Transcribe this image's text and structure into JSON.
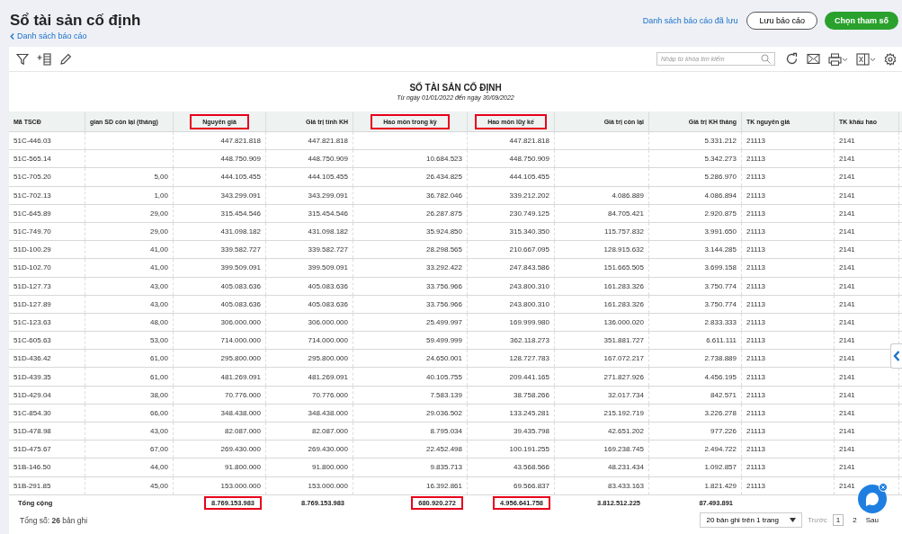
{
  "page": {
    "title": "Sổ tài sản cố định",
    "back_link": "Danh sách báo cáo",
    "saved_reports_link": "Danh sách báo cáo đã lưu",
    "save_button": "Lưu báo cáo",
    "params_button": "Chọn tham số"
  },
  "toolbar": {
    "search": {
      "placeholder": "Nhập từ khóa tìm kiếm"
    }
  },
  "report": {
    "title": "SỐ TÀI SẢN CỐ ĐỊNH",
    "subtitle": "Từ ngày 01/01/2022 đến ngày 30/09/2022"
  },
  "table": {
    "columns": [
      {
        "label": "Mã TSCĐ",
        "highlighted": false
      },
      {
        "label": "gian SD còn lại (tháng)",
        "highlighted": false
      },
      {
        "label": "Nguyên giá",
        "highlighted": true
      },
      {
        "label": "Giá trị tính KH",
        "highlighted": false
      },
      {
        "label": "Hao mòn trong kỳ",
        "highlighted": true
      },
      {
        "label": "Hao mòn lũy kế",
        "highlighted": true
      },
      {
        "label": "Giá trị còn lại",
        "highlighted": false
      },
      {
        "label": "Giá trị KH tháng",
        "highlighted": false
      },
      {
        "label": "TK nguyên giá",
        "highlighted": false
      },
      {
        "label": "TK khấu hao",
        "highlighted": false
      }
    ],
    "rows": [
      [
        "51C-446.03",
        "",
        "447.821.818",
        "447.821.818",
        "",
        "447.821.818",
        "",
        "5.331.212",
        "21113",
        "2141"
      ],
      [
        "51C-565.14",
        "",
        "448.750.909",
        "448.750.909",
        "10.684.523",
        "448.750.909",
        "",
        "5.342.273",
        "21113",
        "2141"
      ],
      [
        "51C-705.20",
        "5,00",
        "444.105.455",
        "444.105.455",
        "26.434.825",
        "444.105.455",
        "",
        "5.286.970",
        "21113",
        "2141"
      ],
      [
        "51C-702.13",
        "1,00",
        "343.299.091",
        "343.299.091",
        "36.782.046",
        "339.212.202",
        "4.086.889",
        "4.086.894",
        "21113",
        "2141"
      ],
      [
        "51C-645.89",
        "29,00",
        "315.454.546",
        "315.454.546",
        "26.287.875",
        "230.749.125",
        "84.705.421",
        "2.920.875",
        "21113",
        "2141"
      ],
      [
        "51C-749.70",
        "29,00",
        "431.098.182",
        "431.098.182",
        "35.924.850",
        "315.340.350",
        "115.757.832",
        "3.991.650",
        "21113",
        "2141"
      ],
      [
        "51D-100.29",
        "41,00",
        "339.582.727",
        "339.582.727",
        "28.298.565",
        "210.667.095",
        "128.915.632",
        "3.144.285",
        "21113",
        "2141"
      ],
      [
        "51D-102.70",
        "41,00",
        "399.509.091",
        "399.509.091",
        "33.292.422",
        "247.843.586",
        "151.665.505",
        "3.699.158",
        "21113",
        "2141"
      ],
      [
        "51D-127.73",
        "43,00",
        "405.083.636",
        "405.083.636",
        "33.756.966",
        "243.800.310",
        "161.283.326",
        "3.750.774",
        "21113",
        "2141"
      ],
      [
        "51D-127.89",
        "43,00",
        "405.083.636",
        "405.083.636",
        "33.756.966",
        "243.800.310",
        "161.283.326",
        "3.750.774",
        "21113",
        "2141"
      ],
      [
        "51C-123.63",
        "48,00",
        "306.000.000",
        "306.000.000",
        "25.499.997",
        "169.999.980",
        "136.000.020",
        "2.833.333",
        "21113",
        "2141"
      ],
      [
        "51C-605.63",
        "53,00",
        "714.000.000",
        "714.000.000",
        "59.499.999",
        "362.118.273",
        "351.881.727",
        "6.611.111",
        "21113",
        "2141"
      ],
      [
        "51D-436.42",
        "61,00",
        "295.800.000",
        "295.800.000",
        "24.650.001",
        "128.727.783",
        "167.072.217",
        "2.738.889",
        "21113",
        "2141"
      ],
      [
        "51D-439.35",
        "61,00",
        "481.269.091",
        "481.269.091",
        "40.105.755",
        "209.441.165",
        "271.827.926",
        "4.456.195",
        "21113",
        "2141"
      ],
      [
        "51D-429.04",
        "38,00",
        "70.776.000",
        "70.776.000",
        "7.583.139",
        "38.758.266",
        "32.017.734",
        "842.571",
        "21113",
        "2141"
      ],
      [
        "51C-854.30",
        "66,00",
        "348.438.000",
        "348.438.000",
        "29.036.502",
        "133.245.281",
        "215.192.719",
        "3.226.278",
        "21113",
        "2141"
      ],
      [
        "51D-478.98",
        "43,00",
        "82.087.000",
        "82.087.000",
        "8.795.034",
        "39.435.798",
        "42.651.202",
        "977.226",
        "21113",
        "2141"
      ],
      [
        "51D-475.67",
        "67,00",
        "269.430.000",
        "269.430.000",
        "22.452.498",
        "100.191.255",
        "169.238.745",
        "2.494.722",
        "21113",
        "2141"
      ],
      [
        "51B-146.50",
        "44,00",
        "91.800.000",
        "91.800.000",
        "9.835.713",
        "43.568.566",
        "48.231.434",
        "1.092.857",
        "21113",
        "2141"
      ],
      [
        "51B-291.85",
        "45,00",
        "153.000.000",
        "153.000.000",
        "16.392.861",
        "69.566.837",
        "83.433.163",
        "1.821.429",
        "21113",
        "2141"
      ]
    ],
    "totals": {
      "label": "Tổng cộng",
      "cells": [
        {
          "text": "8.769.153.983",
          "highlighted": true
        },
        {
          "text": "8.769.153.983",
          "highlighted": false
        },
        {
          "text": "680.920.272",
          "highlighted": true
        },
        {
          "text": "4.956.641.758",
          "highlighted": true
        },
        {
          "text": "3.812.512.225",
          "highlighted": false
        },
        {
          "text": "87.493.891",
          "highlighted": false
        }
      ]
    }
  },
  "footer": {
    "total_label": "Tổng số:",
    "total_count": "26",
    "total_unit": "bản ghi",
    "page_size": "20 bản ghi trên 1 trang",
    "prev": "Trước",
    "pages": [
      {
        "label": "1",
        "selected": true
      },
      {
        "label": "2",
        "selected": false
      }
    ],
    "next": "Sau"
  }
}
